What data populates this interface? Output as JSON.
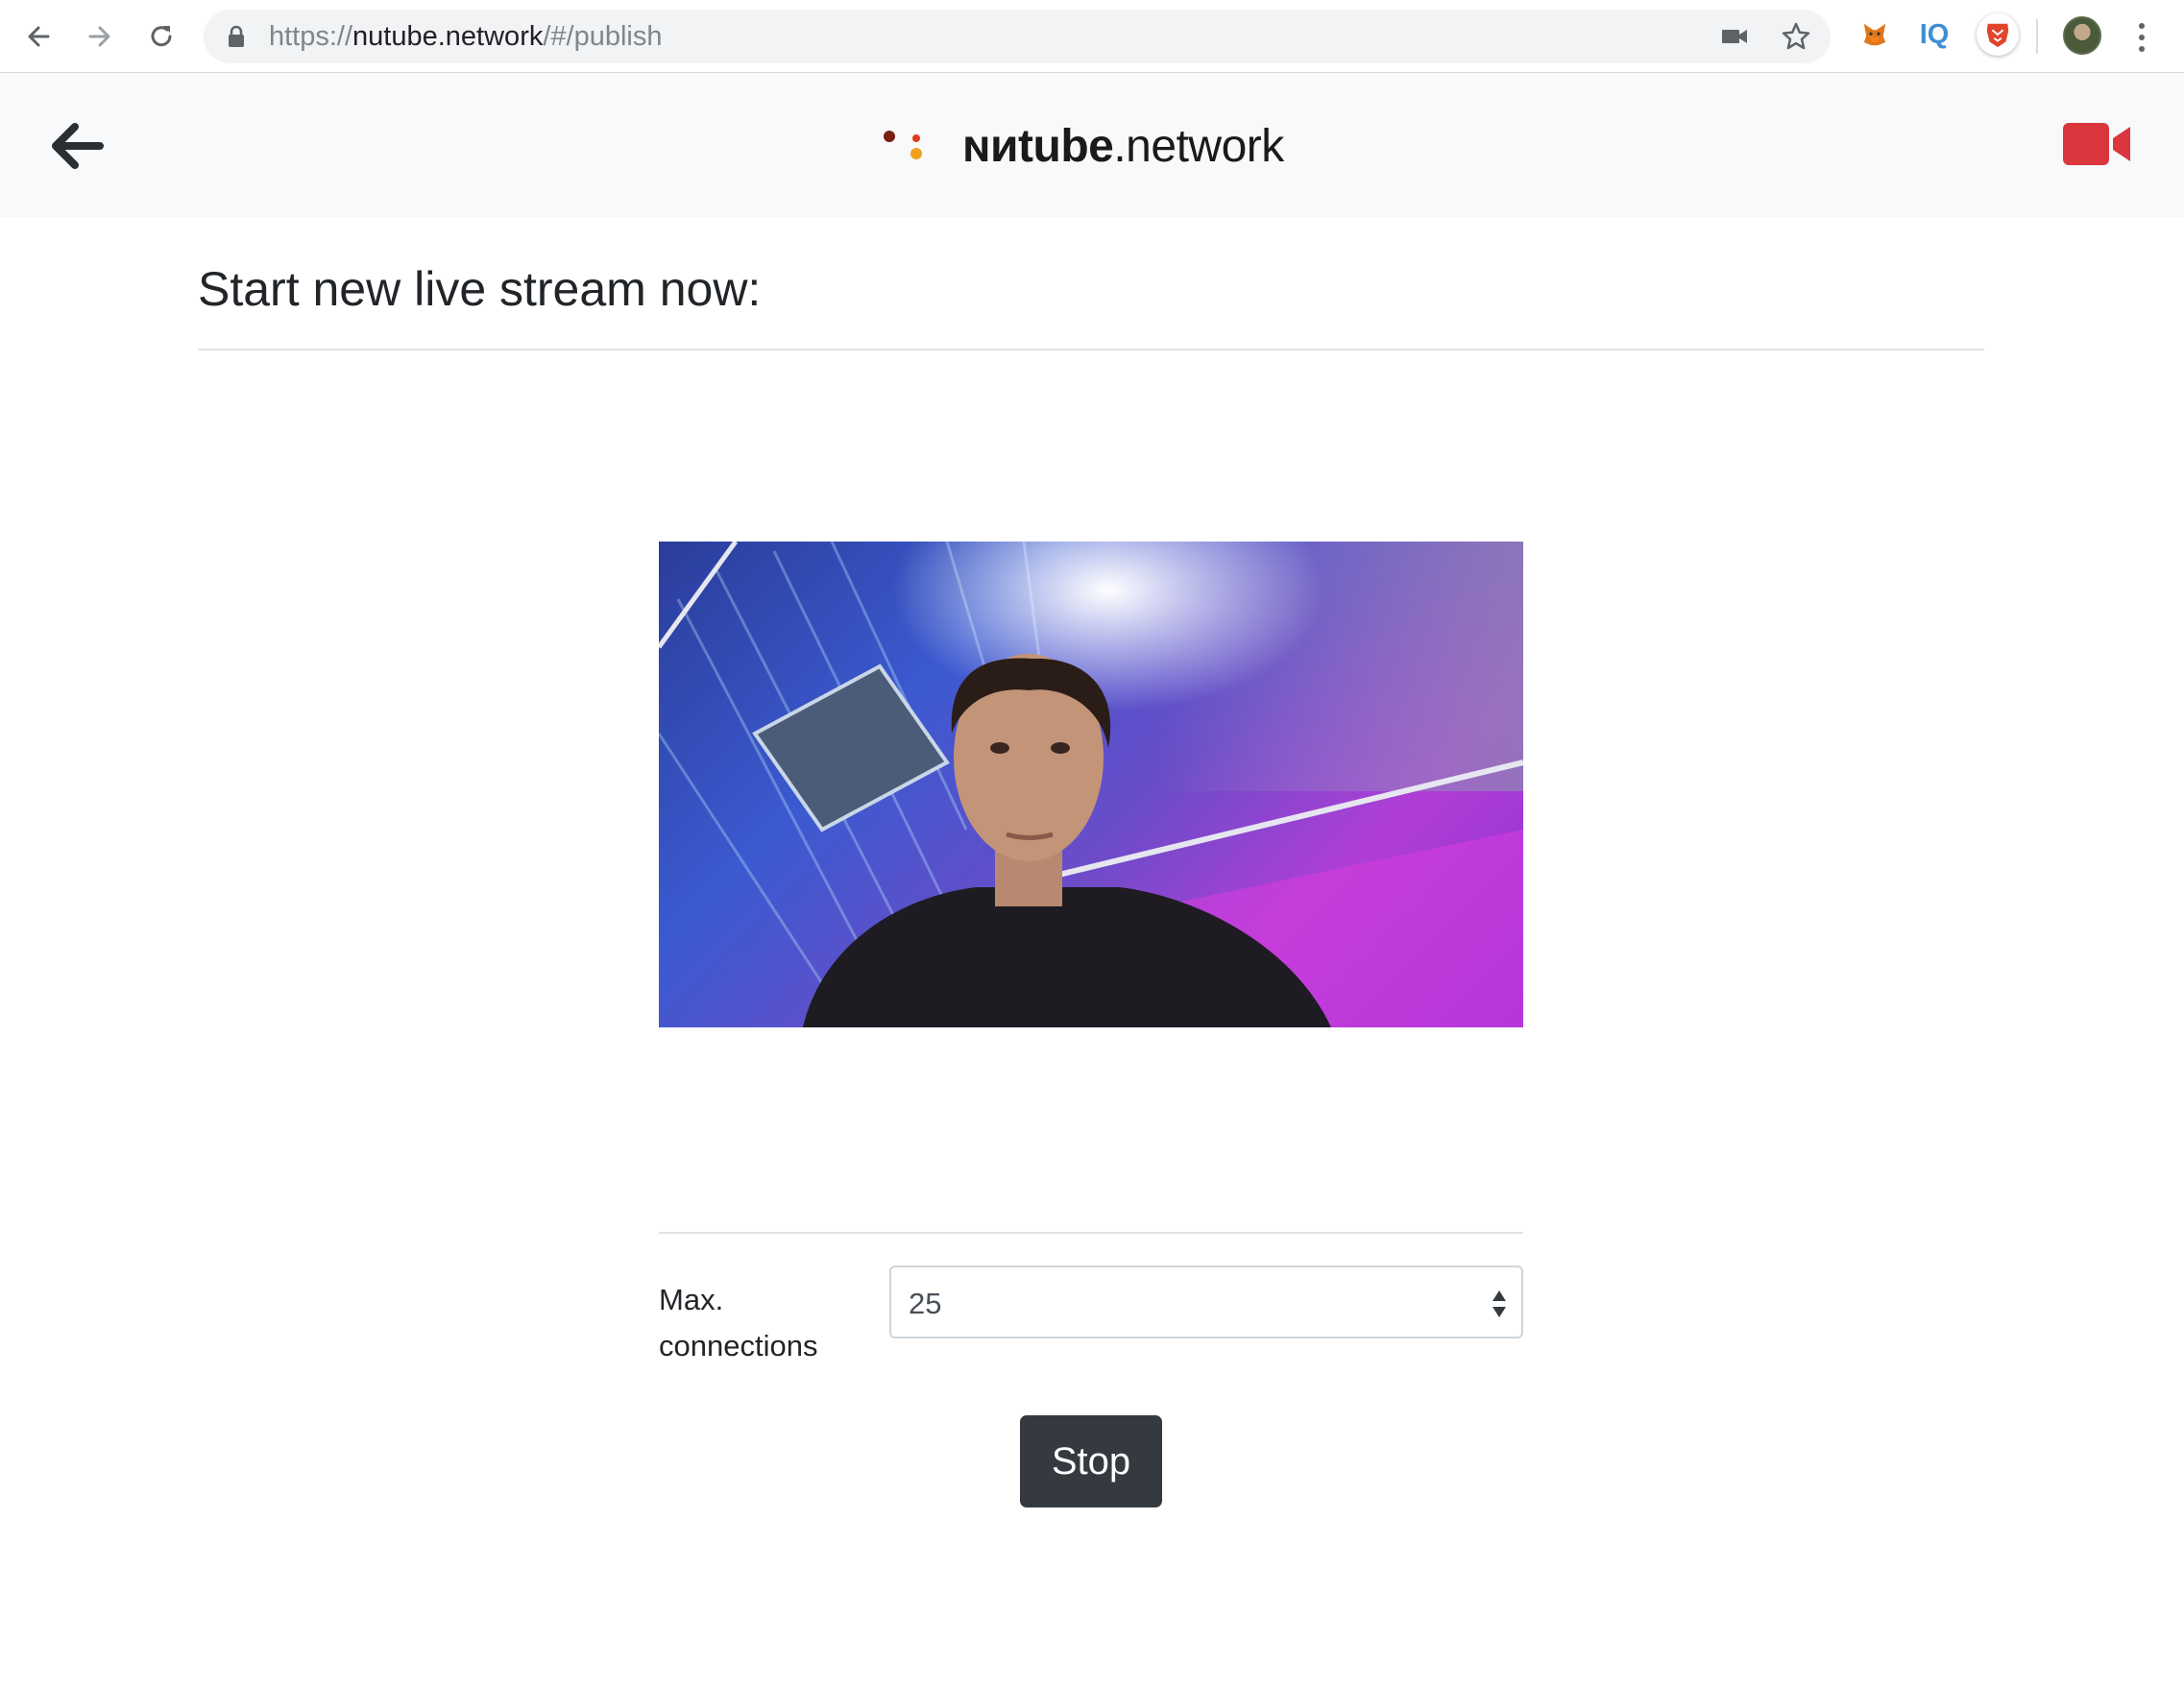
{
  "browser": {
    "url_scheme": "https://",
    "url_host": "nutube.network",
    "url_path": "/#/publish",
    "extensions": {
      "metamask_icon": "fox-icon",
      "iq_label": "IQ",
      "brave_icon": "lion-shield-icon"
    }
  },
  "header": {
    "logo_bold": "ɴиtube",
    "logo_rest": ".network",
    "video_icon_color": "#d9363e"
  },
  "page": {
    "title": "Start new live stream now:"
  },
  "form": {
    "max_connections_label": "Max. connections",
    "max_connections_value": "25",
    "stop_label": "Stop"
  },
  "colors": {
    "header_bg": "#f8f9fa",
    "button_bg": "#343a40",
    "accent_red": "#d9363e"
  }
}
